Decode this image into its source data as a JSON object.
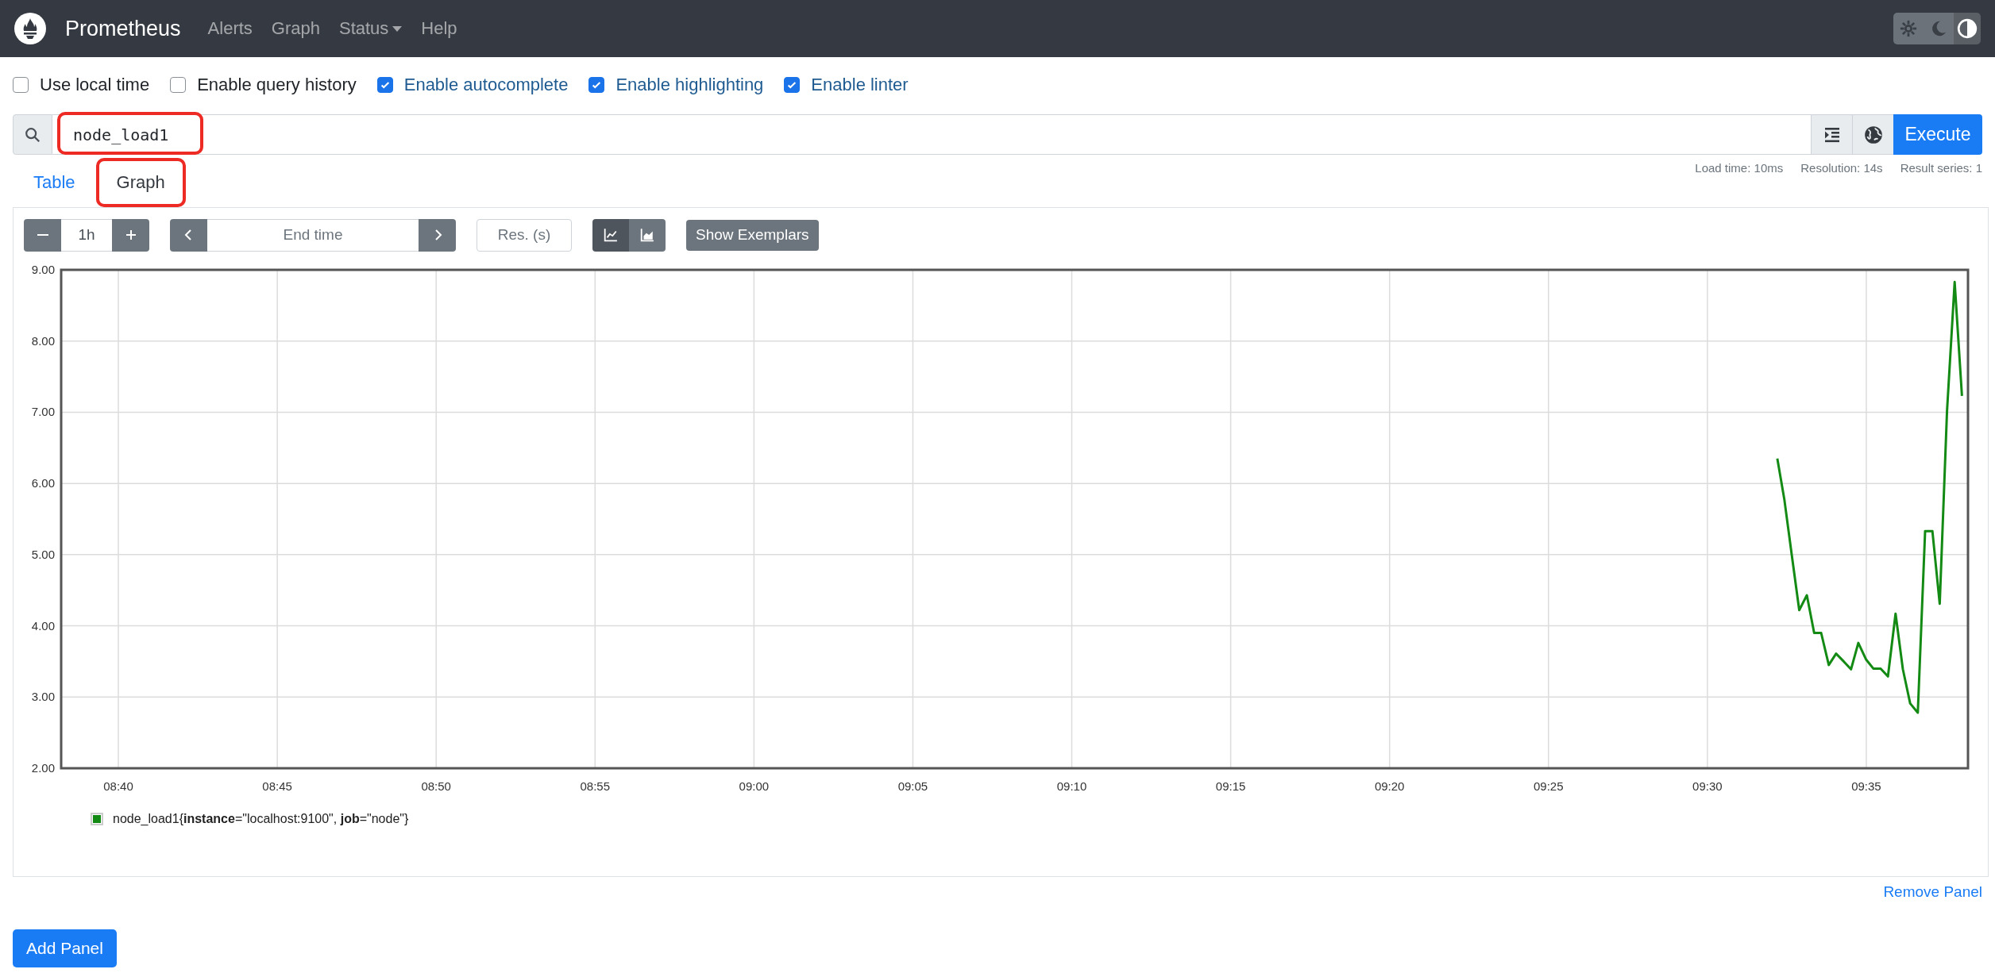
{
  "navbar": {
    "brand": "Prometheus",
    "links": [
      {
        "label": "Alerts",
        "dropdown": false
      },
      {
        "label": "Graph",
        "dropdown": false
      },
      {
        "label": "Status",
        "dropdown": true
      },
      {
        "label": "Help",
        "dropdown": false
      }
    ],
    "theme_buttons": [
      {
        "kind": "light",
        "selected": false
      },
      {
        "kind": "dark",
        "selected": false
      },
      {
        "kind": "auto",
        "selected": true
      }
    ]
  },
  "options": [
    {
      "label": "Use local time",
      "checked": false
    },
    {
      "label": "Enable query history",
      "checked": false
    },
    {
      "label": "Enable autocomplete",
      "checked": true
    },
    {
      "label": "Enable highlighting",
      "checked": true
    },
    {
      "label": "Enable linter",
      "checked": true
    }
  ],
  "query": {
    "value": "node_load1",
    "highlighted": true
  },
  "execute_button": "Execute",
  "stats": [
    "Load time: 10ms",
    "Resolution: 14s",
    "Result series: 1"
  ],
  "tabs": [
    {
      "label": "Table",
      "selected": false,
      "highlighted": false
    },
    {
      "label": "Graph",
      "selected": true,
      "highlighted": true
    }
  ],
  "controls": {
    "range": "1h",
    "end_time_placeholder": "End time",
    "resolution_placeholder": "Res. (s)",
    "chart_types": [
      {
        "kind": "lines",
        "selected": true
      },
      {
        "kind": "stacked",
        "selected": false
      }
    ],
    "exemplars_button": "Show Exemplars"
  },
  "chart": {
    "chart_data": {
      "type": "line",
      "grid": true,
      "xlim": [
        518.2,
        578.2
      ],
      "ylim": [
        2,
        9
      ],
      "xticks": [
        {
          "value": 520,
          "label": "08:40"
        },
        {
          "value": 525,
          "label": "08:45"
        },
        {
          "value": 530,
          "label": "08:50"
        },
        {
          "value": 535,
          "label": "08:55"
        },
        {
          "value": 540,
          "label": "09:00"
        },
        {
          "value": 545,
          "label": "09:05"
        },
        {
          "value": 550,
          "label": "09:10"
        },
        {
          "value": 555,
          "label": "09:15"
        },
        {
          "value": 560,
          "label": "09:20"
        },
        {
          "value": 565,
          "label": "09:25"
        },
        {
          "value": 570,
          "label": "09:30"
        },
        {
          "value": 575,
          "label": "09:35"
        }
      ],
      "yticks": [
        {
          "value": 2,
          "label": "2.00"
        },
        {
          "value": 3,
          "label": "3.00"
        },
        {
          "value": 4,
          "label": "4.00"
        },
        {
          "value": 5,
          "label": "5.00"
        },
        {
          "value": 6,
          "label": "6.00"
        },
        {
          "value": 7,
          "label": "7.00"
        },
        {
          "value": 8,
          "label": "8.00"
        },
        {
          "value": 9,
          "label": "9.00"
        }
      ],
      "x": [
        572.2,
        572.42,
        572.66,
        572.89,
        573.13,
        573.36,
        573.58,
        573.82,
        574.05,
        574.29,
        574.52,
        574.75,
        574.99,
        575.22,
        575.45,
        575.68,
        575.92,
        576.15,
        576.38,
        576.62,
        576.85,
        577.08,
        577.31,
        577.54,
        577.78,
        578.01
      ],
      "series": [
        {
          "name": "node_load1{**instance**=\"localhost:9100\", **job**=\"node\"}",
          "color": "#138a13",
          "values": [
            6.35,
            5.78,
            4.98,
            4.22,
            4.43,
            3.9,
            3.9,
            3.45,
            3.61,
            3.5,
            3.39,
            3.76,
            3.53,
            3.4,
            3.4,
            3.29,
            4.17,
            3.39,
            2.91,
            2.78,
            5.33,
            5.33,
            4.31,
            7.02,
            8.83,
            7.23
          ]
        }
      ]
    }
  },
  "remove_panel": "Remove Panel",
  "add_panel": "Add Panel"
}
